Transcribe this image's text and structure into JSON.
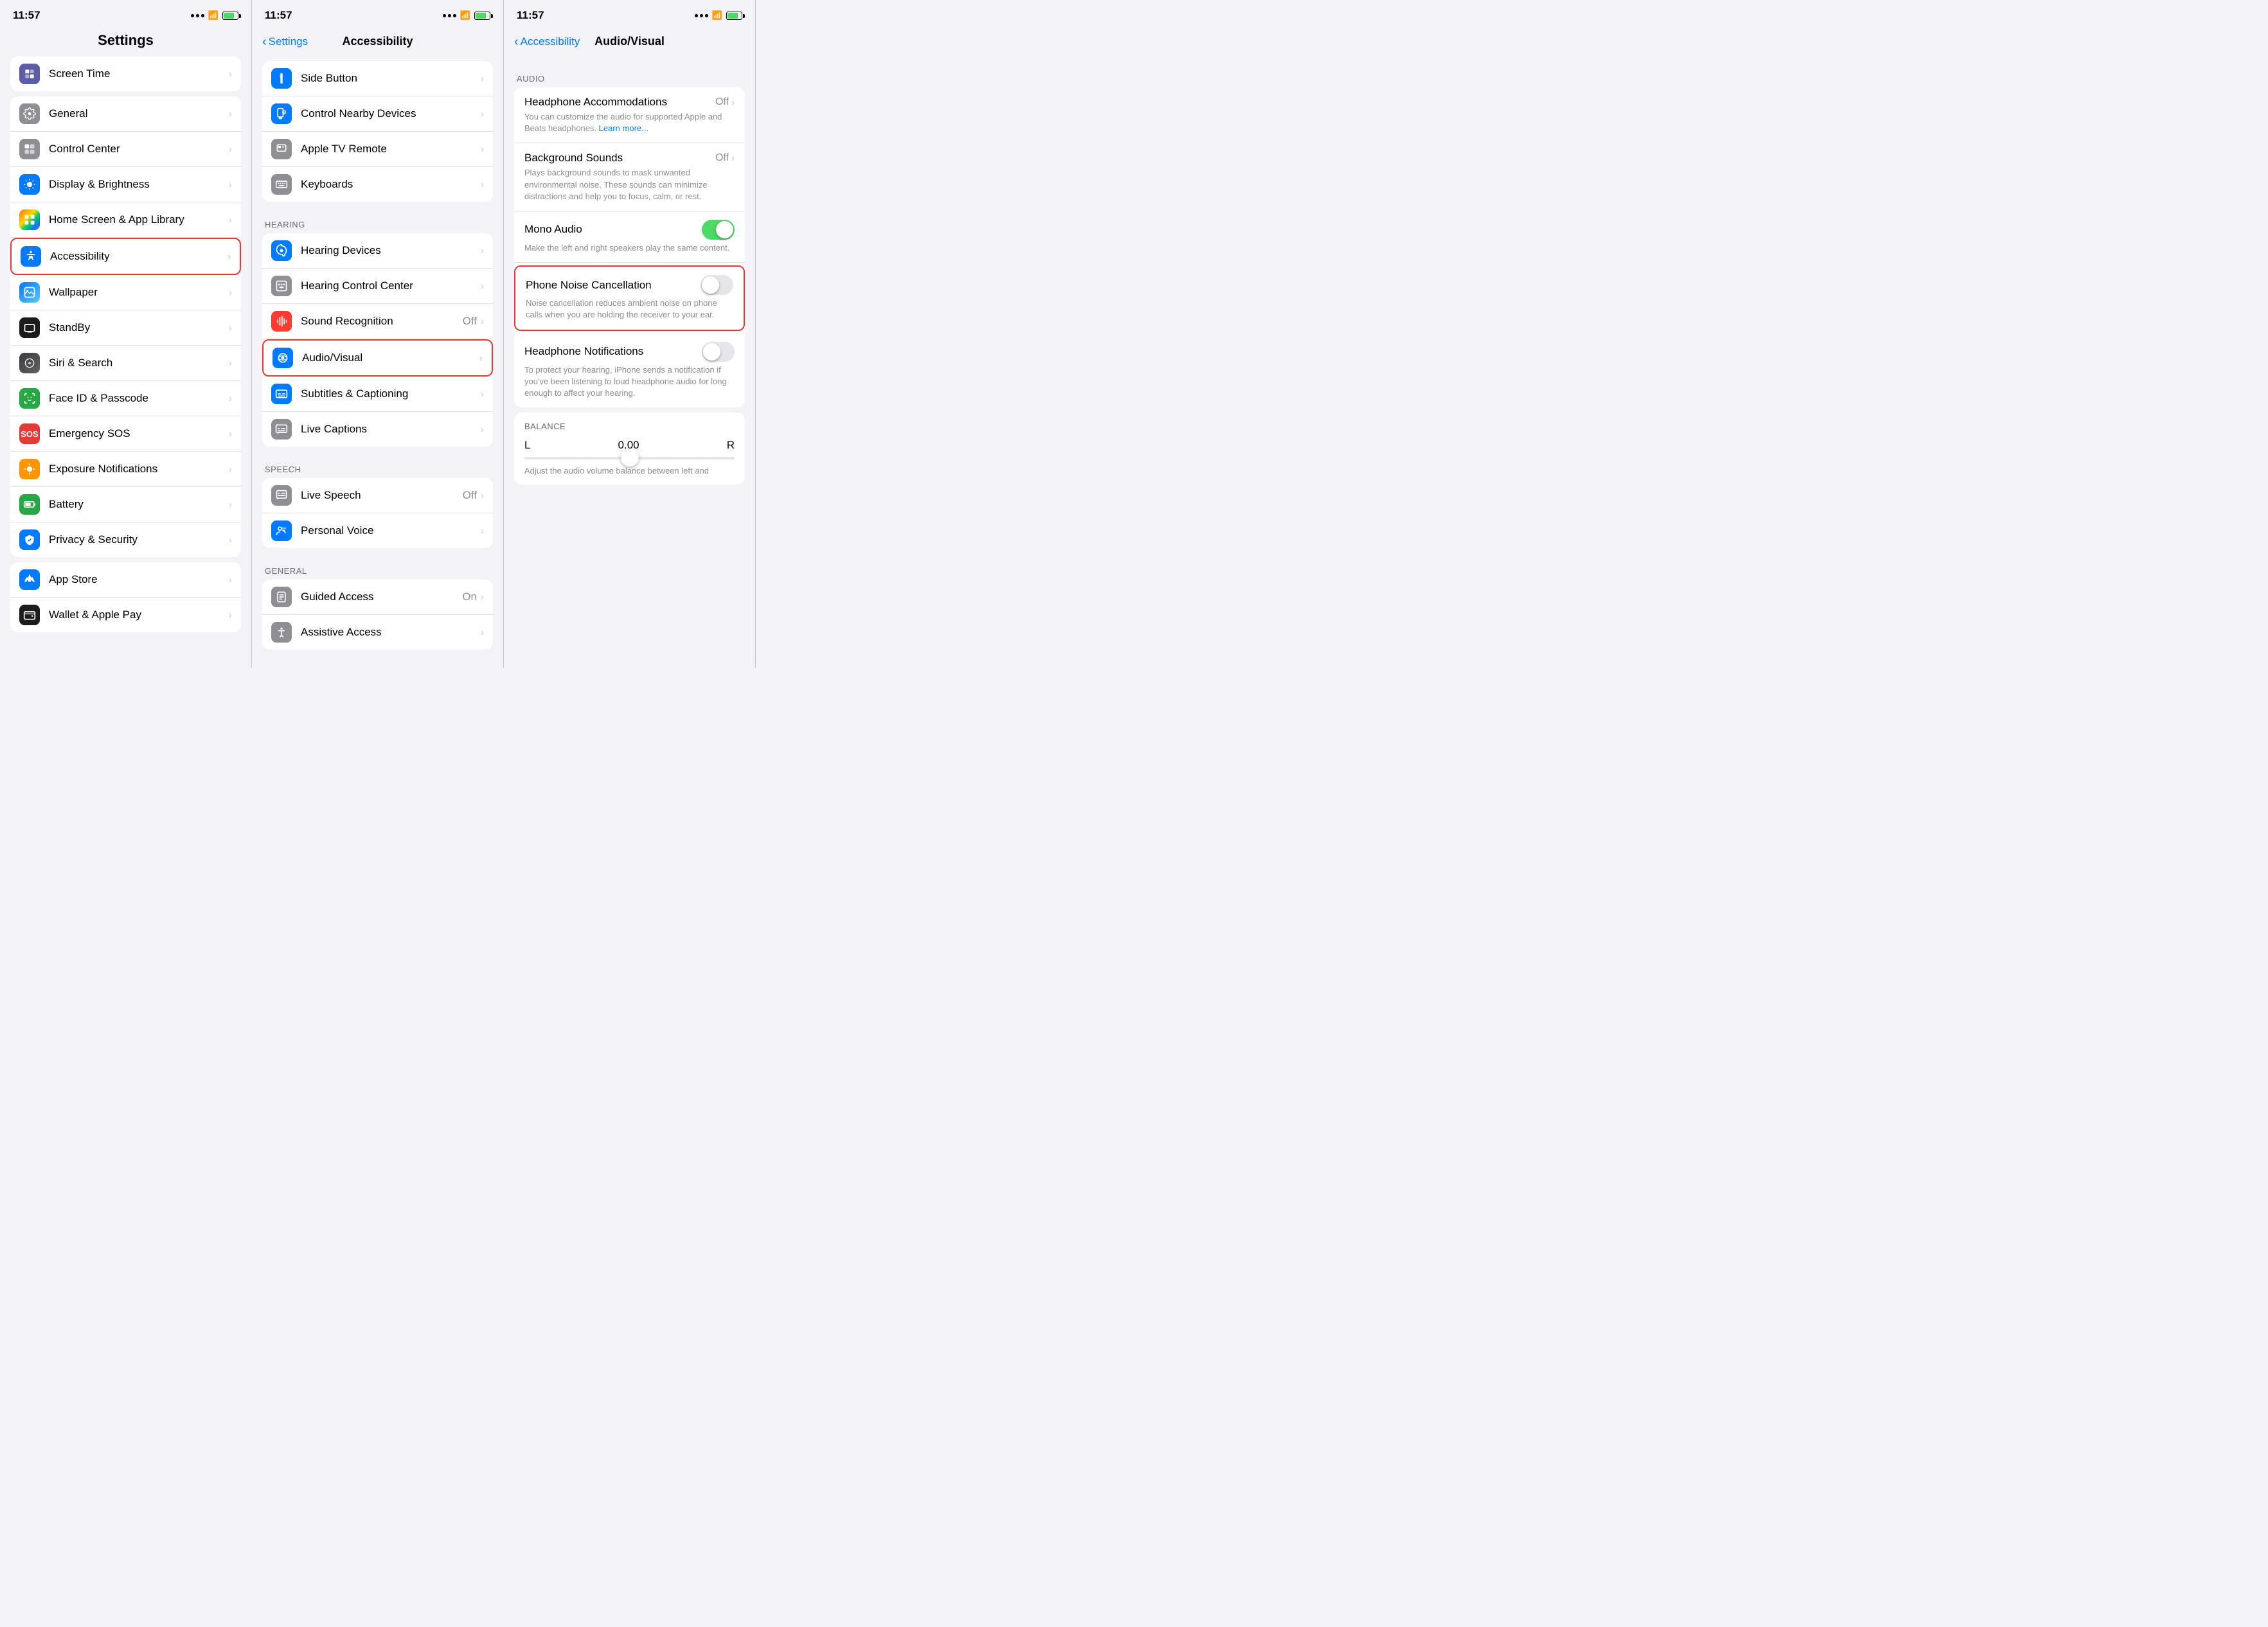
{
  "panels": {
    "left": {
      "time": "11:57",
      "title": "Settings",
      "items": [
        {
          "id": "screen-time",
          "label": "Screen Time",
          "icon": "screen-time",
          "iconBg": "#5c5ca7",
          "value": "",
          "highlighted": false
        },
        {
          "id": "general",
          "label": "General",
          "icon": "general",
          "iconBg": "#8e8e93",
          "value": "",
          "highlighted": false
        },
        {
          "id": "control-center",
          "label": "Control Center",
          "icon": "control-center",
          "iconBg": "#8e8e93",
          "value": "",
          "highlighted": false
        },
        {
          "id": "display-brightness",
          "label": "Display & Brightness",
          "icon": "display",
          "iconBg": "#007aff",
          "value": "",
          "highlighted": false
        },
        {
          "id": "home-screen",
          "label": "Home Screen & App Library",
          "icon": "home-screen",
          "iconBg": "gradient",
          "value": "",
          "highlighted": false
        },
        {
          "id": "accessibility",
          "label": "Accessibility",
          "icon": "accessibility",
          "iconBg": "#007aff",
          "value": "",
          "highlighted": true
        },
        {
          "id": "wallpaper",
          "label": "Wallpaper",
          "icon": "wallpaper",
          "iconBg": "gradient",
          "value": "",
          "highlighted": false
        },
        {
          "id": "standby",
          "label": "StandBy",
          "icon": "standby",
          "iconBg": "#1c1c1e",
          "value": "",
          "highlighted": false
        },
        {
          "id": "siri-search",
          "label": "Siri & Search",
          "icon": "siri",
          "iconBg": "gradient-dark",
          "value": "",
          "highlighted": false
        },
        {
          "id": "face-id",
          "label": "Face ID & Passcode",
          "icon": "faceid",
          "iconBg": "#28a745",
          "value": "",
          "highlighted": false
        },
        {
          "id": "emergency-sos",
          "label": "Emergency SOS",
          "icon": "emergency",
          "iconBg": "#e53935",
          "value": "",
          "highlighted": false
        },
        {
          "id": "exposure",
          "label": "Exposure Notifications",
          "icon": "exposure",
          "iconBg": "#ff9500",
          "value": "",
          "highlighted": false
        },
        {
          "id": "battery",
          "label": "Battery",
          "icon": "battery",
          "iconBg": "#28a745",
          "value": "",
          "highlighted": false
        },
        {
          "id": "privacy",
          "label": "Privacy & Security",
          "icon": "privacy",
          "iconBg": "#007aff",
          "value": "",
          "highlighted": false
        }
      ],
      "bottom_items": [
        {
          "id": "app-store",
          "label": "App Store",
          "icon": "appstore",
          "iconBg": "#007aff",
          "value": "",
          "highlighted": false
        },
        {
          "id": "wallet",
          "label": "Wallet & Apple Pay",
          "icon": "wallet",
          "iconBg": "#1c1c1e",
          "value": "",
          "highlighted": false
        }
      ]
    },
    "middle": {
      "time": "11:57",
      "back_label": "Settings",
      "title": "Accessibility",
      "sections": [
        {
          "header": "",
          "items": [
            {
              "id": "side-button",
              "label": "Side Button",
              "icon": "side-btn",
              "iconBg": "#007aff",
              "value": "",
              "highlighted": false
            },
            {
              "id": "control-nearby",
              "label": "Control Nearby Devices",
              "icon": "nearby",
              "iconBg": "#007aff",
              "value": "",
              "highlighted": false
            },
            {
              "id": "apple-tv-remote",
              "label": "Apple TV Remote",
              "icon": "appletv",
              "iconBg": "#8e8e93",
              "value": "",
              "highlighted": false
            },
            {
              "id": "keyboards",
              "label": "Keyboards",
              "icon": "keyboard",
              "iconBg": "#8e8e93",
              "value": "",
              "highlighted": false
            }
          ]
        },
        {
          "header": "HEARING",
          "items": [
            {
              "id": "hearing-devices",
              "label": "Hearing Devices",
              "icon": "hearing-dev",
              "iconBg": "#007aff",
              "value": "",
              "highlighted": false
            },
            {
              "id": "hearing-control",
              "label": "Hearing Control Center",
              "icon": "hearing-ctrl",
              "iconBg": "#8e8e93",
              "value": "",
              "highlighted": false
            },
            {
              "id": "sound-recognition",
              "label": "Sound Recognition",
              "icon": "sound-rec",
              "iconBg": "#ff3b30",
              "value": "Off",
              "highlighted": false
            },
            {
              "id": "audiovisual",
              "label": "Audio/Visual",
              "icon": "audiovisual",
              "iconBg": "#007aff",
              "value": "",
              "highlighted": true
            },
            {
              "id": "subtitles",
              "label": "Subtitles & Captioning",
              "icon": "subtitles",
              "iconBg": "#007aff",
              "value": "",
              "highlighted": false
            },
            {
              "id": "live-captions",
              "label": "Live Captions",
              "icon": "live-captions",
              "iconBg": "#8e8e93",
              "value": "",
              "highlighted": false
            }
          ]
        },
        {
          "header": "SPEECH",
          "items": [
            {
              "id": "live-speech",
              "label": "Live Speech",
              "icon": "live-speech",
              "iconBg": "#8e8e93",
              "value": "Off",
              "highlighted": false
            },
            {
              "id": "personal-voice",
              "label": "Personal Voice",
              "icon": "personal-voice",
              "iconBg": "#007aff",
              "value": "",
              "highlighted": false
            }
          ]
        },
        {
          "header": "GENERAL",
          "items": [
            {
              "id": "guided-access",
              "label": "Guided Access",
              "icon": "guided",
              "iconBg": "#8e8e93",
              "value": "On",
              "highlighted": false
            },
            {
              "id": "assistive",
              "label": "Assistive Access",
              "icon": "assistive",
              "iconBg": "#8e8e93",
              "value": "",
              "highlighted": false
            }
          ]
        }
      ]
    },
    "right": {
      "time": "11:57",
      "back_label": "Accessibility",
      "title": "Audio/Visual",
      "audio_header": "AUDIO",
      "items": [
        {
          "id": "headphone-accommodations",
          "label": "Headphone Accommodations",
          "value": "Off",
          "desc": "You can customize the audio for supported Apple and Beats headphones.",
          "learn_more": "Learn more...",
          "type": "nav",
          "highlighted": false
        },
        {
          "id": "background-sounds",
          "label": "Background Sounds",
          "value": "Off",
          "desc": "Plays background sounds to mask unwanted environmental noise. These sounds can minimize distractions and help you to focus, calm, or rest.",
          "type": "nav",
          "highlighted": false
        },
        {
          "id": "mono-audio",
          "label": "Mono Audio",
          "value": "on",
          "desc": "Make the left and right speakers play the same content.",
          "type": "toggle",
          "highlighted": false
        },
        {
          "id": "phone-noise",
          "label": "Phone Noise Cancellation",
          "value": "off",
          "desc": "Noise cancellation reduces ambient noise on phone calls when you are holding the receiver to your ear.",
          "type": "toggle",
          "highlighted": true
        },
        {
          "id": "headphone-notifications",
          "label": "Headphone Notifications",
          "value": "off",
          "desc": "To protect your hearing, iPhone sends a notification if you've been listening to loud headphone audio for long enough to affect your hearing.",
          "type": "toggle",
          "highlighted": false
        }
      ],
      "balance_header": "BALANCE",
      "balance_l": "L",
      "balance_r": "R",
      "balance_value": "0.00",
      "balance_desc": "Adjust the audio volume balance between left and"
    }
  }
}
